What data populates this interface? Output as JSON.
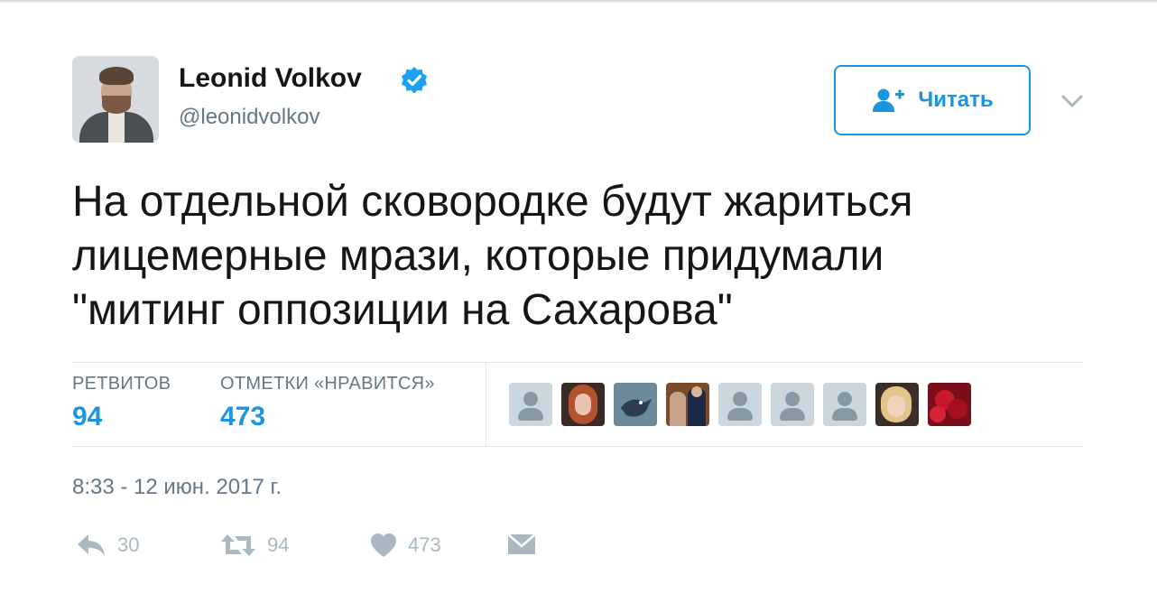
{
  "author": {
    "name": "Leonid Volkov",
    "handle": "@leonidvolkov"
  },
  "follow_button": {
    "label": "Читать"
  },
  "tweet": {
    "lines": [
      "На отдельной сковородке будут жариться",
      "лицемерные мрази, которые придумали",
      "\"митинг оппозиции на Сахарова\""
    ]
  },
  "stats": {
    "retweets_label": "РЕТВИТОВ",
    "retweets_value": "94",
    "likes_label": "ОТМЕТКИ «НРАВИТСЯ»",
    "likes_value": "473"
  },
  "likers": [
    {
      "type": "default"
    },
    {
      "type": "photo-woman-red-hair"
    },
    {
      "type": "bird-icon"
    },
    {
      "type": "photo-group"
    },
    {
      "type": "default"
    },
    {
      "type": "default"
    },
    {
      "type": "default"
    },
    {
      "type": "photo-woman-blonde"
    },
    {
      "type": "photo-roses"
    }
  ],
  "timestamp": "8:33 - 12 июн. 2017 г.",
  "actions": {
    "reply_count": "30",
    "retweet_count": "94",
    "like_count": "473"
  },
  "colors": {
    "accent": "#1b95e0",
    "muted": "#657786",
    "icon": "#aab8c2"
  }
}
